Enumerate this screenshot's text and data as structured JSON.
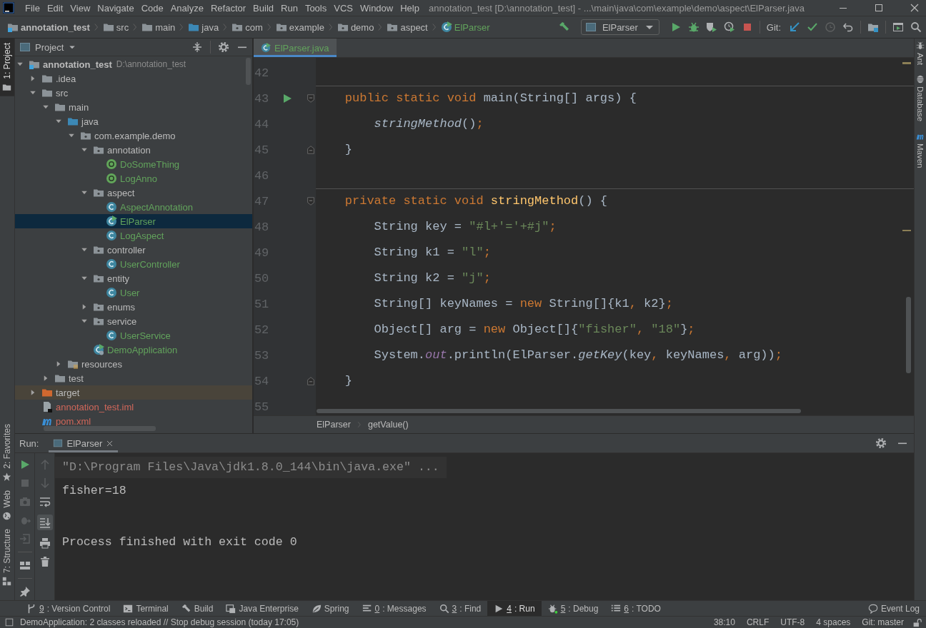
{
  "window": {
    "title": "annotation_test [D:\\annotation_test] - ...\\main\\java\\com\\example\\demo\\aspect\\ElParser.java"
  },
  "menu": [
    "File",
    "Edit",
    "View",
    "Navigate",
    "Code",
    "Analyze",
    "Refactor",
    "Build",
    "Run",
    "Tools",
    "VCS",
    "Window",
    "Help"
  ],
  "breadcrumbs": [
    {
      "label": "annotation_test",
      "kind": "module"
    },
    {
      "label": "src",
      "kind": "folder"
    },
    {
      "label": "main",
      "kind": "folder"
    },
    {
      "label": "java",
      "kind": "source_root"
    },
    {
      "label": "com",
      "kind": "package"
    },
    {
      "label": "example",
      "kind": "package"
    },
    {
      "label": "demo",
      "kind": "package"
    },
    {
      "label": "aspect",
      "kind": "package"
    },
    {
      "label": "ElParser",
      "kind": "main_class"
    }
  ],
  "toolbar": {
    "run_config": "ElParser",
    "vcs_label": "Git:"
  },
  "left_tool_tabs": [
    {
      "label": "1: Project",
      "kind": "project",
      "selected": true
    },
    {
      "label": "2: Favorites",
      "kind": "favorites",
      "selected": false
    },
    {
      "label": "Web",
      "kind": "web",
      "selected": false
    },
    {
      "label": "7: Structure",
      "kind": "structure",
      "selected": false
    }
  ],
  "right_tool_tabs": [
    {
      "label": "Ant",
      "kind": "ant"
    },
    {
      "label": "Database",
      "kind": "database"
    },
    {
      "label": "Maven",
      "kind": "maven"
    }
  ],
  "project": {
    "title": "Project",
    "tree": [
      {
        "label": "annotation_test",
        "hint": "D:\\annotation_test",
        "kind": "module",
        "color": "#bbbbbb",
        "expanded": true,
        "selected": false,
        "children": [
          {
            "label": ".idea",
            "kind": "folder",
            "color": "#bbbbbb",
            "expanded": false,
            "selected": false
          },
          {
            "label": "src",
            "kind": "folder",
            "color": "#bbbbbb",
            "expanded": true,
            "selected": false,
            "children": [
              {
                "label": "main",
                "kind": "folder",
                "color": "#bbbbbb",
                "expanded": true,
                "selected": false,
                "children": [
                  {
                    "label": "java",
                    "kind": "source_root",
                    "color": "#bbbbbb",
                    "expanded": true,
                    "selected": false,
                    "children": [
                      {
                        "label": "com.example.demo",
                        "kind": "package",
                        "color": "#bbbbbb",
                        "expanded": true,
                        "selected": false,
                        "children": [
                          {
                            "label": "annotation",
                            "kind": "package",
                            "color": "#bbbbbb",
                            "expanded": true,
                            "selected": false,
                            "children": [
                              {
                                "label": "DoSomeThing",
                                "kind": "annotation",
                                "color": "#62a35c",
                                "selected": false
                              },
                              {
                                "label": "LogAnno",
                                "kind": "annotation",
                                "color": "#62a35c",
                                "selected": false
                              }
                            ]
                          },
                          {
                            "label": "aspect",
                            "kind": "package",
                            "color": "#bbbbbb",
                            "expanded": true,
                            "selected": false,
                            "children": [
                              {
                                "label": "AspectAnnotation",
                                "kind": "class",
                                "color": "#62a35c",
                                "selected": false
                              },
                              {
                                "label": "ElParser",
                                "kind": "main_class",
                                "color": "#62a35c",
                                "selected": true
                              },
                              {
                                "label": "LogAspect",
                                "kind": "class",
                                "color": "#62a35c",
                                "selected": false
                              }
                            ]
                          },
                          {
                            "label": "controller",
                            "kind": "package",
                            "color": "#bbbbbb",
                            "expanded": true,
                            "selected": false,
                            "children": [
                              {
                                "label": "UserController",
                                "kind": "class",
                                "color": "#62a35c",
                                "selected": false
                              }
                            ]
                          },
                          {
                            "label": "entity",
                            "kind": "package",
                            "color": "#bbbbbb",
                            "expanded": true,
                            "selected": false,
                            "children": [
                              {
                                "label": "User",
                                "kind": "class",
                                "color": "#62a35c",
                                "selected": false
                              }
                            ]
                          },
                          {
                            "label": "enums",
                            "kind": "package",
                            "color": "#bbbbbb",
                            "expanded": false,
                            "selected": false
                          },
                          {
                            "label": "service",
                            "kind": "package",
                            "color": "#bbbbbb",
                            "expanded": true,
                            "selected": false,
                            "children": [
                              {
                                "label": "UserService",
                                "kind": "class",
                                "color": "#62a35c",
                                "selected": false
                              }
                            ]
                          },
                          {
                            "label": "DemoApplication",
                            "kind": "spring_app",
                            "color": "#62a35c",
                            "selected": false
                          }
                        ]
                      }
                    ]
                  },
                  {
                    "label": "resources",
                    "kind": "resources",
                    "color": "#bbbbbb",
                    "expanded": false,
                    "selected": false
                  }
                ]
              },
              {
                "label": "test",
                "kind": "folder",
                "color": "#bbbbbb",
                "expanded": false,
                "selected": false
              }
            ]
          },
          {
            "label": "target",
            "kind": "excluded",
            "color": "#bbbbbb",
            "expanded": false,
            "selected": false
          },
          {
            "label": "annotation_test.iml",
            "kind": "iml",
            "color": "#d1675a",
            "selected": false
          },
          {
            "label": "pom.xml",
            "kind": "maven",
            "color": "#d1675a",
            "selected": false
          }
        ]
      }
    ]
  },
  "editor": {
    "tabs": [
      {
        "label": "ElParser.java",
        "selected": true
      }
    ],
    "lines": [
      {
        "number": "42",
        "run": false,
        "separator": false,
        "fold_start": false,
        "fold_end": false
      },
      {
        "number": "43",
        "run": true,
        "separator": true,
        "fold_start": true,
        "fold_end": false,
        "tokens": [
          {
            "text": "    public static void ",
            "kind": "keyword"
          },
          {
            "text": "main(String[] args) {",
            "kind": "plain"
          }
        ]
      },
      {
        "number": "44",
        "run": false,
        "separator": false,
        "fold_start": false,
        "fold_end": false,
        "tokens": [
          {
            "text": "        stringMethod",
            "kind": "call"
          },
          {
            "text": "()",
            "kind": "plain"
          },
          {
            "text": ";",
            "kind": "punct"
          }
        ]
      },
      {
        "number": "45",
        "run": false,
        "separator": false,
        "fold_start": false,
        "fold_end": true,
        "tokens": [
          {
            "text": "    }",
            "kind": "plain"
          }
        ]
      },
      {
        "number": "46",
        "run": false,
        "separator": false,
        "fold_start": false,
        "fold_end": false
      },
      {
        "number": "47",
        "run": false,
        "separator": true,
        "fold_start": true,
        "fold_end": false,
        "tokens": [
          {
            "text": "    private static void ",
            "kind": "keyword"
          },
          {
            "text": "stringMethod",
            "kind": "declaration"
          },
          {
            "text": "() {",
            "kind": "plain"
          }
        ]
      },
      {
        "number": "48",
        "run": false,
        "separator": false,
        "fold_start": false,
        "fold_end": false,
        "tokens": [
          {
            "text": "        String key = ",
            "kind": "plain"
          },
          {
            "text": "\"#l+'='+#j\"",
            "kind": "string"
          },
          {
            "text": ";",
            "kind": "punct"
          }
        ]
      },
      {
        "number": "49",
        "run": false,
        "separator": false,
        "fold_start": false,
        "fold_end": false,
        "tokens": [
          {
            "text": "        String k1 = ",
            "kind": "plain"
          },
          {
            "text": "\"l\"",
            "kind": "string"
          },
          {
            "text": ";",
            "kind": "punct"
          }
        ]
      },
      {
        "number": "50",
        "run": false,
        "separator": false,
        "fold_start": false,
        "fold_end": false,
        "tokens": [
          {
            "text": "        String k2 = ",
            "kind": "plain"
          },
          {
            "text": "\"j\"",
            "kind": "string"
          },
          {
            "text": ";",
            "kind": "punct"
          }
        ]
      },
      {
        "number": "51",
        "run": false,
        "separator": false,
        "fold_start": false,
        "fold_end": false,
        "tokens": [
          {
            "text": "        String[] keyNames = ",
            "kind": "plain"
          },
          {
            "text": "new",
            "kind": "keyword"
          },
          {
            "text": " String[]{k1",
            "kind": "plain"
          },
          {
            "text": ",",
            "kind": "punct"
          },
          {
            "text": " k2}",
            "kind": "plain"
          },
          {
            "text": ";",
            "kind": "punct"
          }
        ]
      },
      {
        "number": "52",
        "run": false,
        "separator": false,
        "fold_start": false,
        "fold_end": false,
        "tokens": [
          {
            "text": "        Object[] arg = ",
            "kind": "plain"
          },
          {
            "text": "new",
            "kind": "keyword"
          },
          {
            "text": " Object[]{",
            "kind": "plain"
          },
          {
            "text": "\"fisher\"",
            "kind": "string"
          },
          {
            "text": ",",
            "kind": "punct"
          },
          {
            "text": " \"18\"",
            "kind": "string"
          },
          {
            "text": "}",
            "kind": "plain"
          },
          {
            "text": ";",
            "kind": "punct"
          }
        ]
      },
      {
        "number": "53",
        "run": false,
        "separator": false,
        "fold_start": false,
        "fold_end": false,
        "tokens": [
          {
            "text": "        System.",
            "kind": "plain"
          },
          {
            "text": "out",
            "kind": "static_field"
          },
          {
            "text": ".println(ElParser.",
            "kind": "plain"
          },
          {
            "text": "getKey",
            "kind": "call"
          },
          {
            "text": "(key",
            "kind": "plain"
          },
          {
            "text": ",",
            "kind": "punct"
          },
          {
            "text": " keyNames",
            "kind": "plain"
          },
          {
            "text": ",",
            "kind": "punct"
          },
          {
            "text": " arg))",
            "kind": "plain"
          },
          {
            "text": ";",
            "kind": "punct"
          }
        ]
      },
      {
        "number": "54",
        "run": false,
        "separator": false,
        "fold_start": false,
        "fold_end": true,
        "tokens": [
          {
            "text": "    }",
            "kind": "plain"
          }
        ]
      },
      {
        "number": "55",
        "run": false,
        "separator": false,
        "fold_start": false,
        "fold_end": false
      }
    ],
    "breadcrumb": [
      "ElParser",
      "getValue()"
    ]
  },
  "run": {
    "label": "Run:",
    "tab": {
      "label": "ElParser",
      "selected": true
    },
    "scroll_to_end": true,
    "console": [
      {
        "text": "\"D:\\Program Files\\Java\\jdk1.8.0_144\\bin\\java.exe\" ...",
        "kind": "command"
      },
      {
        "text": "fisher=18",
        "kind": "output"
      },
      {
        "text": "Process finished with exit code 0",
        "kind": "exit"
      }
    ]
  },
  "tool_windows": [
    {
      "mnemonic": "9",
      "label": ": Version Control",
      "kind": "vcs",
      "selected": false
    },
    {
      "label": "Terminal",
      "kind": "terminal",
      "selected": false
    },
    {
      "label": "Build",
      "kind": "build",
      "selected": false
    },
    {
      "label": "Java Enterprise",
      "kind": "jee",
      "selected": false
    },
    {
      "label": "Spring",
      "kind": "spring",
      "selected": false
    },
    {
      "mnemonic": "0",
      "label": ": Messages",
      "kind": "messages",
      "selected": false
    },
    {
      "mnemonic": "3",
      "label": ": Find",
      "kind": "find",
      "selected": false
    },
    {
      "mnemonic": "4",
      "label": ": Run",
      "kind": "run",
      "selected": true
    },
    {
      "mnemonic": "5",
      "label": ": Debug",
      "kind": "debug",
      "selected": false
    },
    {
      "mnemonic": "6",
      "label": ": TODO",
      "kind": "todo",
      "selected": false
    }
  ],
  "event_log": "Event Log",
  "status_bar": {
    "message": "DemoApplication: 2 classes reloaded // Stop debug session (today 17:05)",
    "fields": [
      "38:10",
      "CRLF",
      "UTF-8",
      "4 spaces",
      "Git: master"
    ]
  }
}
